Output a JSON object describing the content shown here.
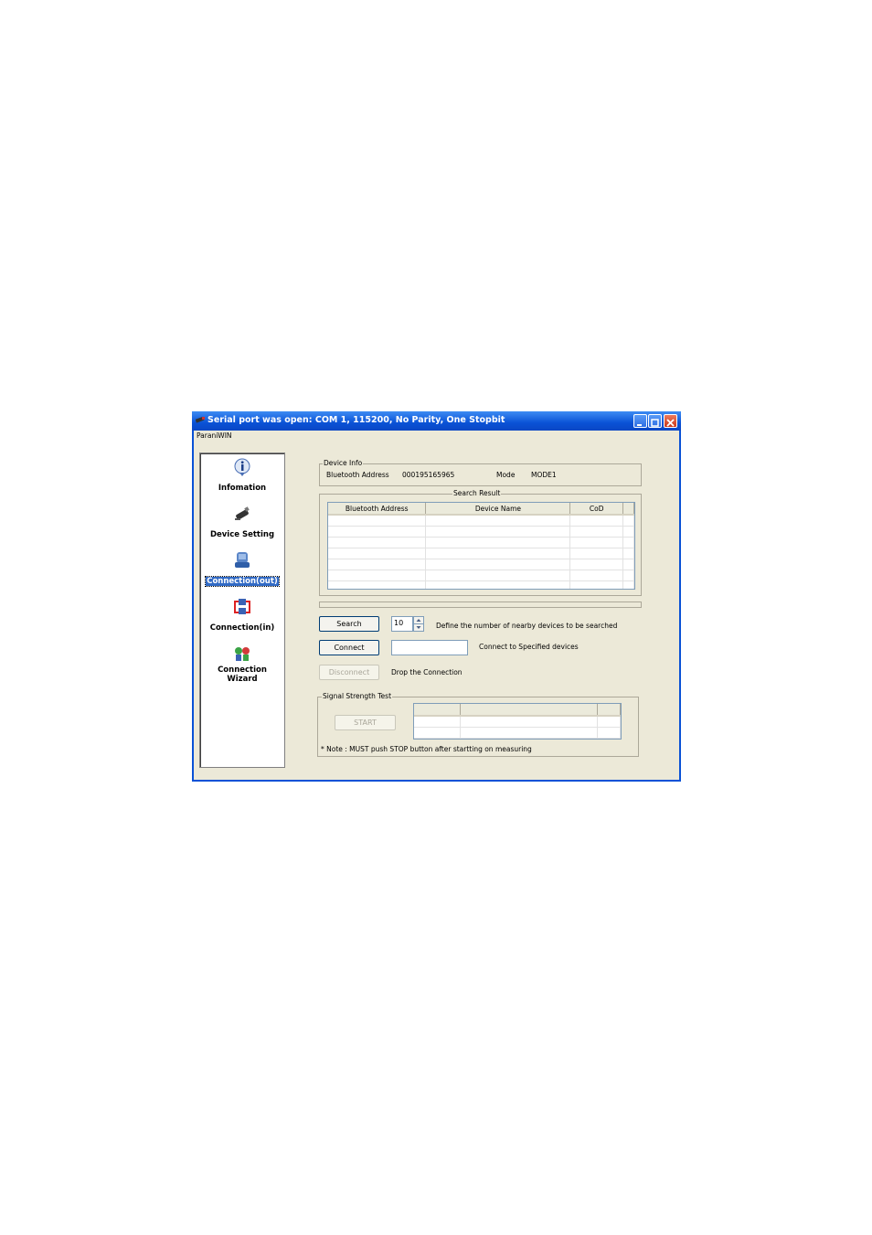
{
  "window": {
    "title": "Serial port was open: COM 1, 115200, No Parity, One Stopbit",
    "menu_label": "ParaniWIN"
  },
  "sidebar": {
    "items": [
      {
        "label": "Infomation",
        "icon": "info-icon"
      },
      {
        "label": "Device Setting",
        "icon": "bluetooth-dongle-icon"
      },
      {
        "label": "Connection(out)",
        "icon": "connection-out-icon",
        "selected": true
      },
      {
        "label": "Connection(in)",
        "icon": "connection-in-icon"
      },
      {
        "label": "Connection Wizard",
        "icon": "wizard-icon"
      }
    ]
  },
  "device_info": {
    "group_label": "Device Info",
    "address_label": "Bluetooth Address",
    "address_value": "000195165965",
    "mode_label": "Mode",
    "mode_value": "MODE1"
  },
  "search_result": {
    "group_label": "Search Result",
    "columns": [
      "Bluetooth Address",
      "Device Name",
      "CoD"
    ]
  },
  "actions": {
    "search_label": "Search",
    "count_value": "10",
    "search_desc": "Define the number of nearby devices to be searched",
    "connect_label": "Connect",
    "connect_value": "",
    "connect_desc": "Connect to Specified devices",
    "disconnect_label": "Disconnect",
    "disconnect_desc": "Drop the Connection"
  },
  "signal_test": {
    "group_label": "Signal Strength Test",
    "start_label": "START",
    "note": "* Note : MUST push STOP button after startting on measuring"
  },
  "colors": {
    "titlebar": "#0a52d6",
    "face": "#ece9d8",
    "selection": "#316ac5"
  }
}
